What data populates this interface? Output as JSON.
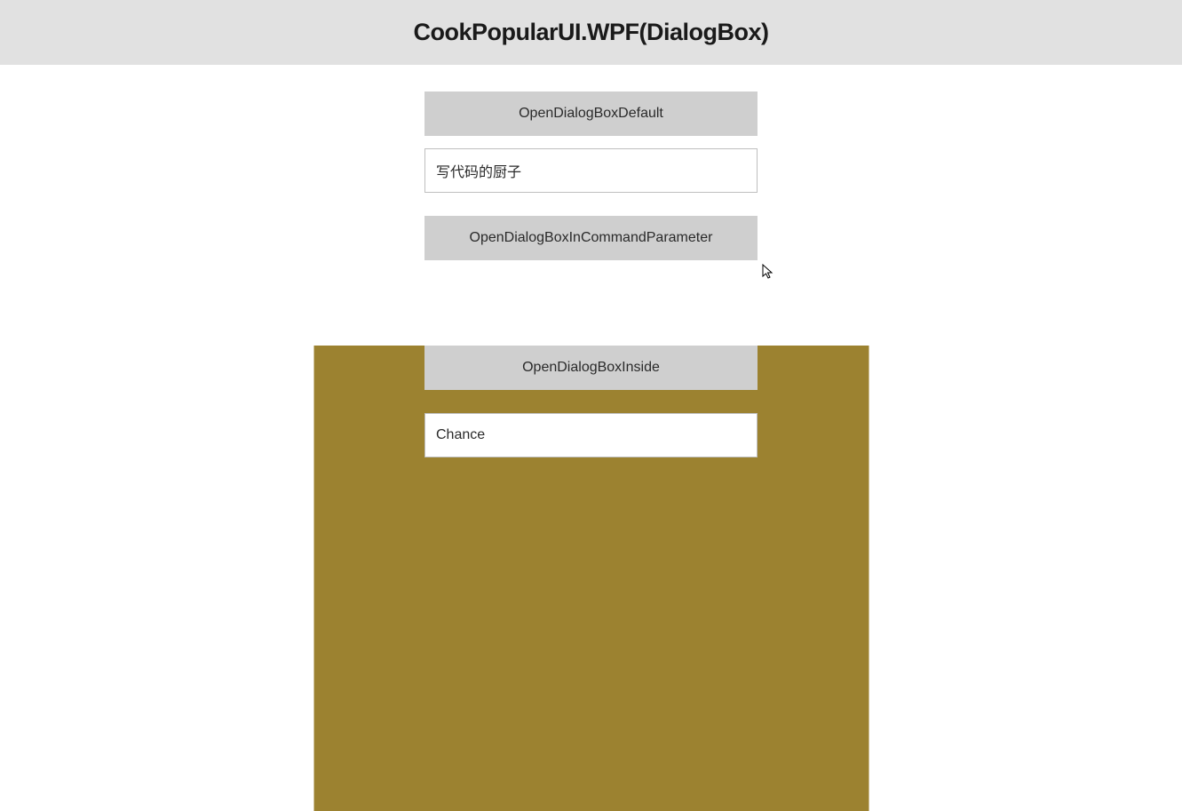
{
  "header": {
    "title": "CookPopularUI.WPF(DialogBox)"
  },
  "buttons": {
    "openDefault": "OpenDialogBoxDefault",
    "openInCommandParameter": "OpenDialogBoxInCommandParameter",
    "openInside": "OpenDialogBoxInside"
  },
  "inputs": {
    "input1": "写代码的厨子",
    "input2": "Chance"
  },
  "colors": {
    "headerBg": "#e1e1e1",
    "buttonBg": "#cfcfcf",
    "panelBg": "#9c8230"
  }
}
